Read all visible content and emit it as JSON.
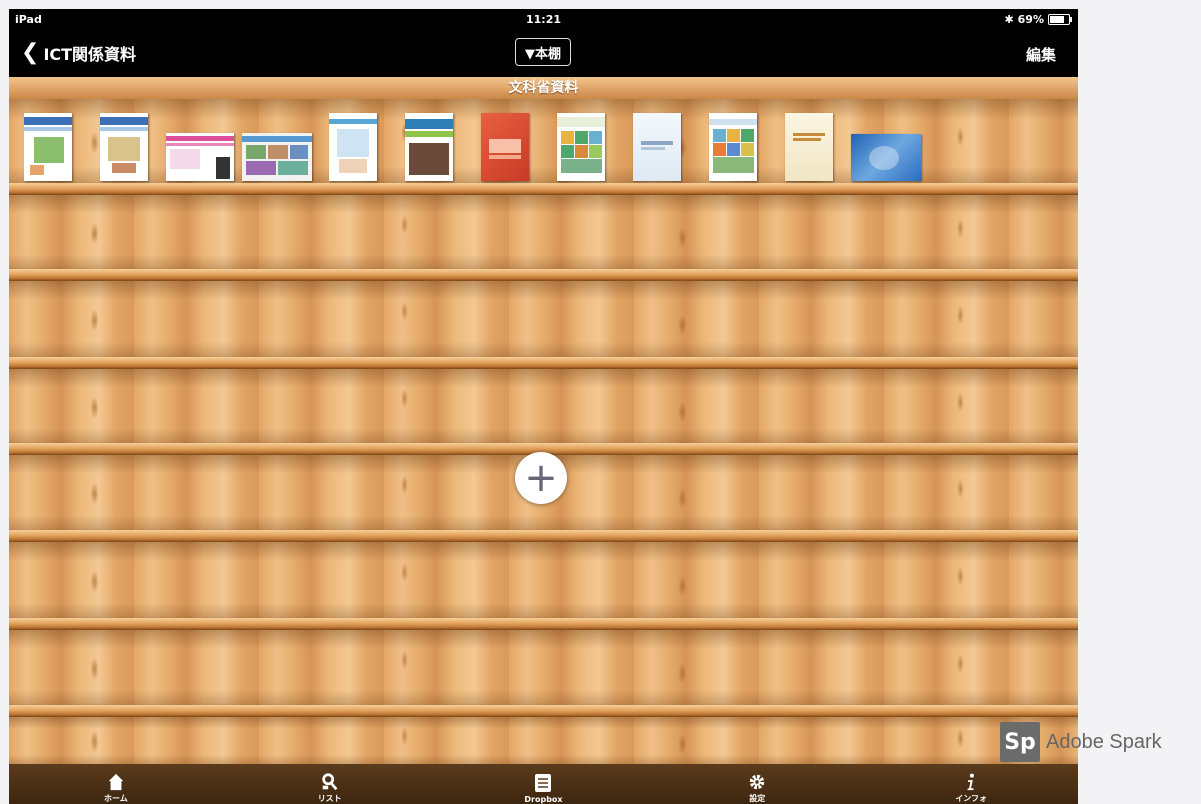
{
  "status_bar": {
    "device": "iPad",
    "time": "11:21",
    "bluetooth": "✱",
    "battery": "69%",
    "battery_level": 0.69
  },
  "nav_bar": {
    "back_label": "ICT関係資料",
    "shelf_picker": "▼本棚",
    "edit_label": "編集"
  },
  "shelf": {
    "title": "文科省資料",
    "book_count_visible": 12,
    "add_symbol": "+"
  },
  "tab_bar": {
    "items": [
      {
        "label": "ホーム",
        "icon": "home-icon"
      },
      {
        "label": "リスト",
        "icon": "list-icon"
      },
      {
        "label": "Dropbox",
        "icon": "dropbox-icon"
      },
      {
        "label": "設定",
        "icon": "gear-icon"
      },
      {
        "label": "インフォ",
        "icon": "info-icon"
      }
    ]
  },
  "watermark": {
    "logo": "Sp",
    "text": "Adobe Spark"
  },
  "colors": {
    "bar_black": "#000000",
    "wood_light": "#f0bf86",
    "wood_dark": "#b97434",
    "tabbar": "#4a2f15"
  }
}
